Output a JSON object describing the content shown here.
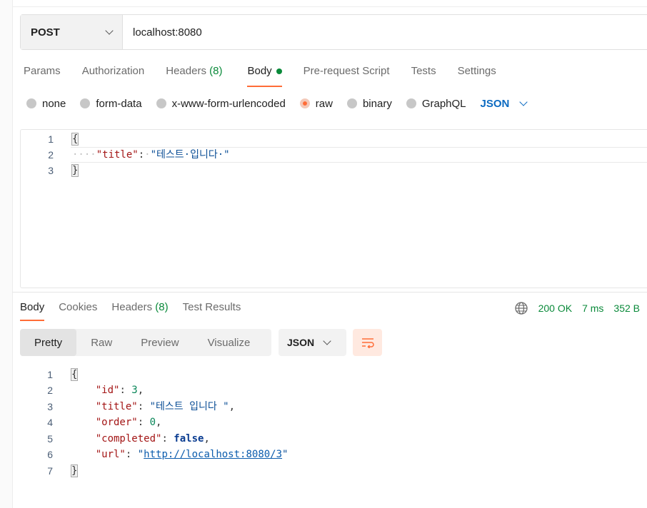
{
  "request": {
    "method": "POST",
    "url": "localhost:8080",
    "tabs": [
      {
        "label": "Params"
      },
      {
        "label": "Authorization"
      },
      {
        "label": "Headers",
        "count": "(8)"
      },
      {
        "label": "Body"
      },
      {
        "label": "Pre-request Script"
      },
      {
        "label": "Tests"
      },
      {
        "label": "Settings"
      }
    ],
    "active_tab": "Body",
    "body_types": [
      "none",
      "form-data",
      "x-www-form-urlencoded",
      "raw",
      "binary",
      "GraphQL"
    ],
    "selected_body_type": "raw",
    "format": "JSON",
    "editor_line_numbers": [
      "1",
      "2",
      "3"
    ],
    "body_code": {
      "open": "{",
      "indent": "····",
      "key": "\"title\"",
      "colon": ":",
      "value": "\"테스트·입니다·\"",
      "close": "}"
    }
  },
  "response": {
    "tabs": [
      {
        "label": "Body"
      },
      {
        "label": "Cookies"
      },
      {
        "label": "Headers",
        "count": "(8)"
      },
      {
        "label": "Test Results"
      }
    ],
    "active_tab": "Body",
    "status": "200 OK",
    "time": "7 ms",
    "size": "352 B",
    "view_modes": [
      "Pretty",
      "Raw",
      "Preview",
      "Visualize"
    ],
    "active_view": "Pretty",
    "format": "JSON",
    "line_numbers": [
      "1",
      "2",
      "3",
      "4",
      "5",
      "6",
      "7"
    ],
    "body": {
      "open": "{",
      "id_key": "\"id\"",
      "id_val": "3",
      "title_key": "\"title\"",
      "title_val": "\"테스트 입니다 \"",
      "order_key": "\"order\"",
      "order_val": "0",
      "completed_key": "\"completed\"",
      "completed_val": "false",
      "url_key": "\"url\"",
      "url_val": "http://localhost:8080/3",
      "close": "}"
    }
  },
  "colors": {
    "accent": "#ff6c37",
    "success": "#0a8a3a",
    "link": "#0b6ac1"
  },
  "icons": [
    "chevron-down-icon",
    "globe-icon",
    "wrap-lines-icon",
    "radio-icon",
    "status-dot-icon"
  ]
}
